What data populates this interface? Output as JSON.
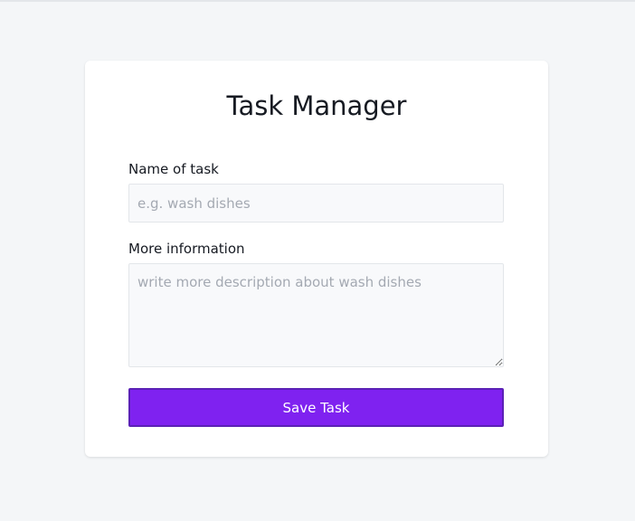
{
  "app": {
    "title": "Task Manager"
  },
  "form": {
    "name_label": "Name of task",
    "name_placeholder": "e.g. wash dishes",
    "name_value": "",
    "info_label": "More information",
    "info_placeholder": "write more description about wash dishes",
    "info_value": "",
    "save_label": "Save Task"
  },
  "colors": {
    "background": "#f4f6f8",
    "card": "#ffffff",
    "accent": "#7f22f0",
    "text": "#161a22",
    "placeholder": "#a4a9b2"
  }
}
